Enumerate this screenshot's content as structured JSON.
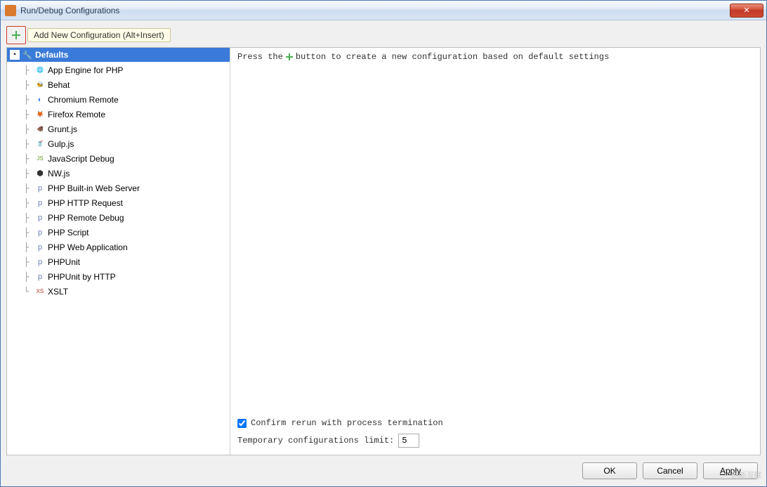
{
  "window": {
    "title": "Run/Debug Configurations"
  },
  "toolbar": {
    "add_tooltip": "Add New Configuration (Alt+Insert)"
  },
  "tree": {
    "root_label": "Defaults",
    "items": [
      {
        "label": "App Engine for PHP",
        "icon": "🌐",
        "color": "#3b8ad9"
      },
      {
        "label": "Behat",
        "icon": "🐝",
        "color": "#8a8a8a"
      },
      {
        "label": "Chromium Remote",
        "icon": "◐",
        "color": "#4285f4"
      },
      {
        "label": "Firefox Remote",
        "icon": "🦊",
        "color": "#e66000"
      },
      {
        "label": "Grunt.js",
        "icon": "🐗",
        "color": "#a05a2c"
      },
      {
        "label": "Gulp.js",
        "icon": "🥤",
        "color": "#cf4647"
      },
      {
        "label": "JavaScript Debug",
        "icon": "JS",
        "color": "#6a9b2a"
      },
      {
        "label": "NW.js",
        "icon": "⬢",
        "color": "#333333"
      },
      {
        "label": "PHP Built-in Web Server",
        "icon": "p",
        "color": "#6a7fb5"
      },
      {
        "label": "PHP HTTP Request",
        "icon": "p",
        "color": "#6a7fb5"
      },
      {
        "label": "PHP Remote Debug",
        "icon": "p",
        "color": "#6a7fb5"
      },
      {
        "label": "PHP Script",
        "icon": "p",
        "color": "#6a7fb5"
      },
      {
        "label": "PHP Web Application",
        "icon": "p",
        "color": "#6a7fb5"
      },
      {
        "label": "PHPUnit",
        "icon": "p",
        "color": "#6a7fb5"
      },
      {
        "label": "PHPUnit by HTTP",
        "icon": "p",
        "color": "#6a7fb5"
      },
      {
        "label": "XSLT",
        "icon": "XS",
        "color": "#c0392b"
      }
    ]
  },
  "right": {
    "instruction_pre": "Press the",
    "instruction_post": "button to create a new configuration based on default settings",
    "confirm_label": "Confirm rerun with process termination",
    "confirm_checked": true,
    "limit_label": "Temporary configurations limit:",
    "limit_value": "5"
  },
  "buttons": {
    "ok": "OK",
    "cancel": "Cancel",
    "apply": "Apply"
  },
  "watermark": "创新互联"
}
